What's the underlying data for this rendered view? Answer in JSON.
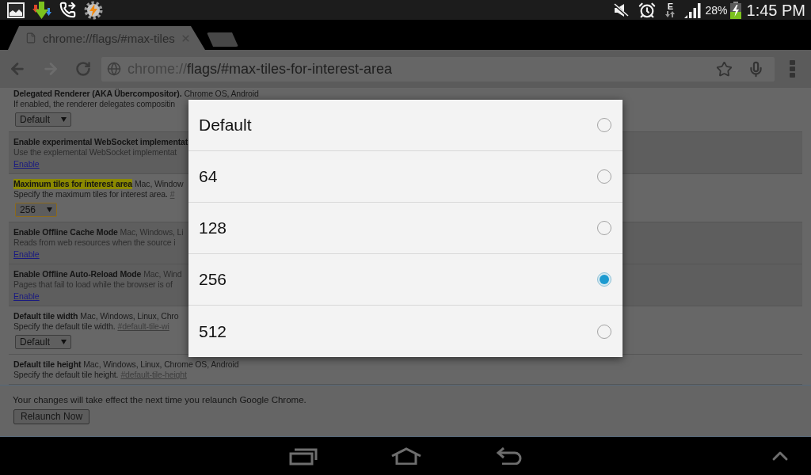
{
  "status_bar": {
    "network_type": "E",
    "battery": "28%",
    "time": "1:45 PM"
  },
  "tabs": [
    {
      "title": "chrome://flags/#max-tiles",
      "selected": true
    }
  ],
  "toolbar": {
    "forward_disabled": true,
    "url_scheme": "chrome://",
    "url_rest": "flags/#max-tiles-for-interest-area"
  },
  "flags": [
    {
      "kind": "select",
      "disabled": false,
      "highlighted": false,
      "title": "Delegated Renderer (AKA Übercompositor).",
      "platforms": "Chrome OS, Android",
      "description": "If enabled, the renderer delegates compositin",
      "value": "Default",
      "focused": false
    },
    {
      "kind": "link",
      "disabled": true,
      "highlighted": false,
      "title": "Enable experimental WebSocket implementat",
      "description": "Use the explemental WebSocket implementat",
      "link": "Enable"
    },
    {
      "kind": "select",
      "disabled": false,
      "highlighted": true,
      "title": "Maximum tiles for interest area",
      "platforms": "Mac, Window",
      "description": "Specify the maximum tiles for interest area.",
      "anchor": "#",
      "value": "256",
      "focused": true
    },
    {
      "kind": "link",
      "disabled": true,
      "highlighted": false,
      "title": "Enable Offline Cache Mode",
      "platforms": "Mac, Windows, Li",
      "description": "Reads from web resources when the source i",
      "link": "Enable"
    },
    {
      "kind": "link",
      "disabled": true,
      "highlighted": false,
      "title": "Enable Offline Auto-Reload Mode",
      "platforms": "Mac, Wind",
      "description": "Pages that fail to load while the browser is of",
      "link": "Enable"
    },
    {
      "kind": "select",
      "disabled": false,
      "highlighted": false,
      "title": "Default tile width",
      "platforms": "Mac, Windows, Linux, Chro",
      "description": "Specify the default tile width.",
      "anchor": "#default-tile-wi",
      "value": "Default",
      "focused": false
    },
    {
      "kind": "text",
      "disabled": false,
      "highlighted": false,
      "title": "Default tile height",
      "platforms": "Mac, Windows, Linux, Chrome OS, Android",
      "description": "Specify the default tile height.",
      "anchor": "#default-tile-height"
    }
  ],
  "footer": {
    "notice": "Your changes will take effect the next time you relaunch Google Chrome.",
    "button": "Relaunch Now"
  },
  "dialog": {
    "options": [
      {
        "label": "Default",
        "selected": false
      },
      {
        "label": "64",
        "selected": false
      },
      {
        "label": "128",
        "selected": false
      },
      {
        "label": "256",
        "selected": true
      },
      {
        "label": "512",
        "selected": false
      }
    ]
  }
}
